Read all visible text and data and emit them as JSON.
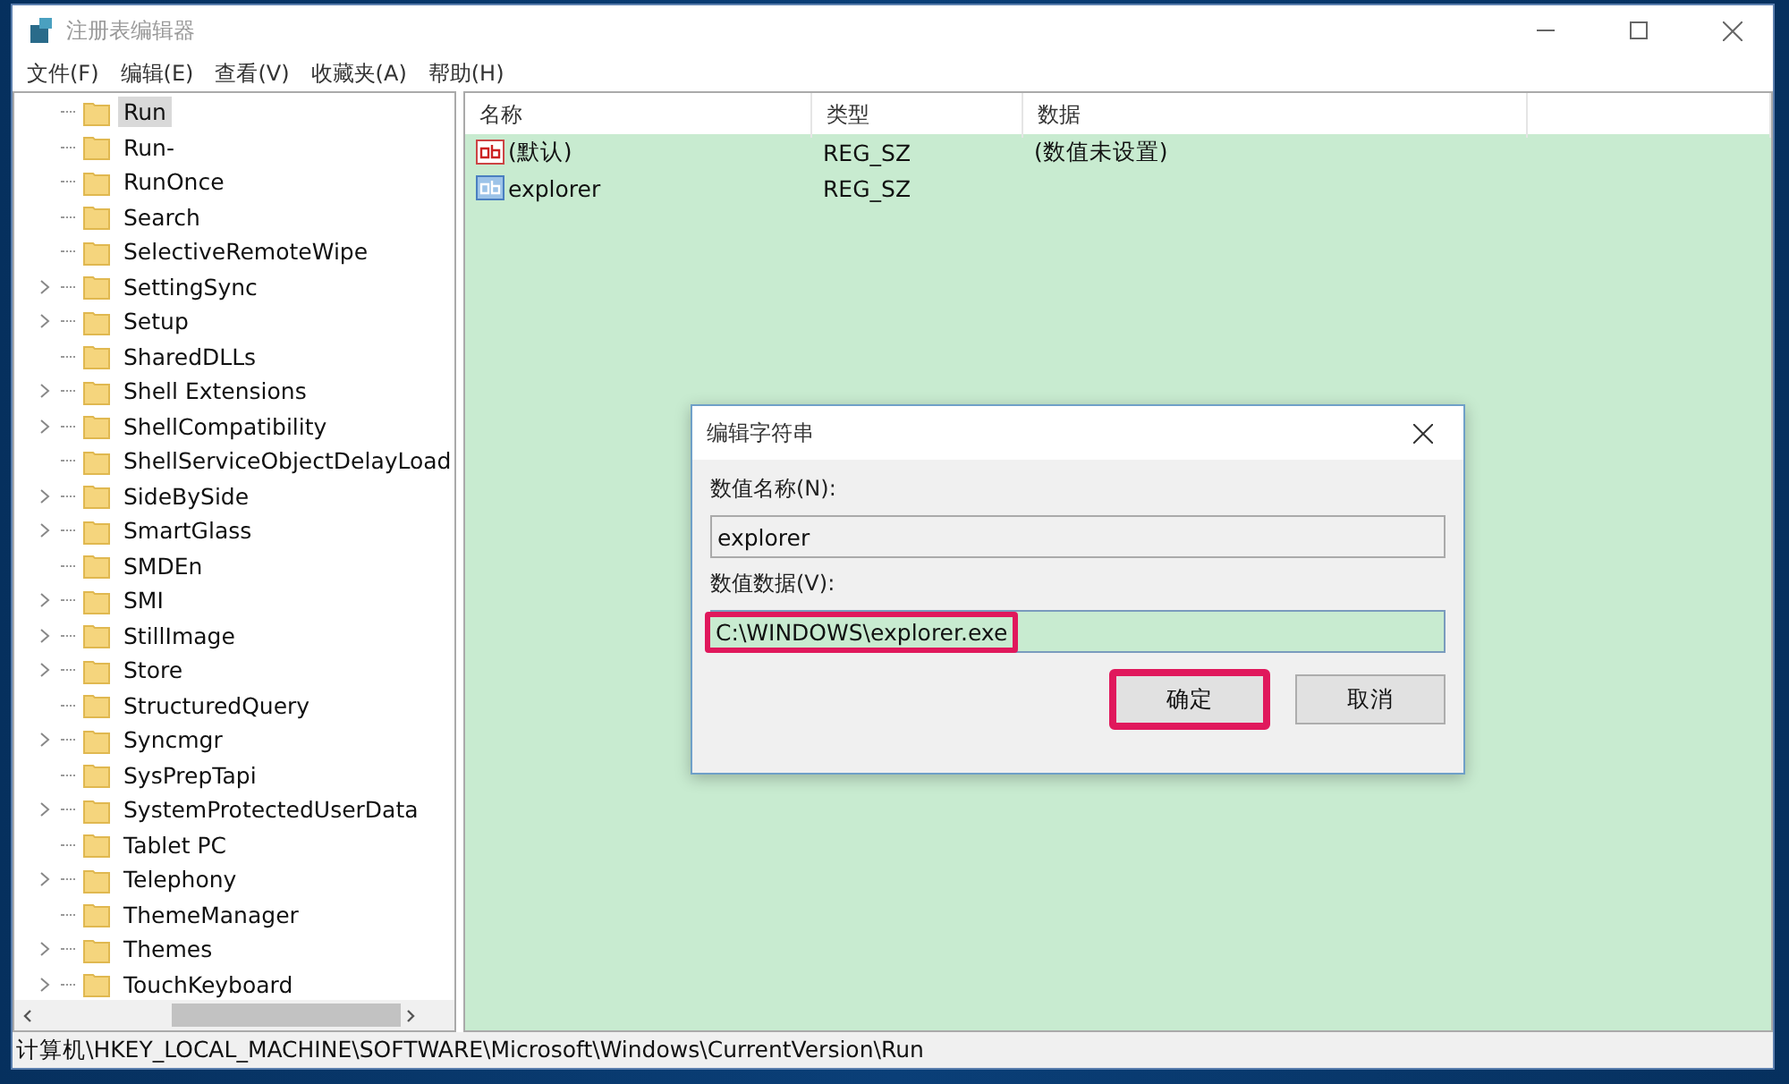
{
  "window": {
    "title": "注册表编辑器"
  },
  "menu": [
    "文件(F)",
    "编辑(E)",
    "查看(V)",
    "收藏夹(A)",
    "帮助(H)"
  ],
  "tree": [
    {
      "label": "Run",
      "expandable": false,
      "selected": true
    },
    {
      "label": "Run-",
      "expandable": false,
      "selected": false
    },
    {
      "label": "RunOnce",
      "expandable": false,
      "selected": false
    },
    {
      "label": "Search",
      "expandable": false,
      "selected": false
    },
    {
      "label": "SelectiveRemoteWipe",
      "expandable": false,
      "selected": false
    },
    {
      "label": "SettingSync",
      "expandable": true,
      "selected": false
    },
    {
      "label": "Setup",
      "expandable": true,
      "selected": false
    },
    {
      "label": "SharedDLLs",
      "expandable": false,
      "selected": false
    },
    {
      "label": "Shell Extensions",
      "expandable": true,
      "selected": false
    },
    {
      "label": "ShellCompatibility",
      "expandable": true,
      "selected": false
    },
    {
      "label": "ShellServiceObjectDelayLoad",
      "expandable": false,
      "selected": false
    },
    {
      "label": "SideBySide",
      "expandable": true,
      "selected": false
    },
    {
      "label": "SmartGlass",
      "expandable": true,
      "selected": false
    },
    {
      "label": "SMDEn",
      "expandable": false,
      "selected": false
    },
    {
      "label": "SMI",
      "expandable": true,
      "selected": false
    },
    {
      "label": "StillImage",
      "expandable": true,
      "selected": false
    },
    {
      "label": "Store",
      "expandable": true,
      "selected": false
    },
    {
      "label": "StructuredQuery",
      "expandable": false,
      "selected": false
    },
    {
      "label": "Syncmgr",
      "expandable": true,
      "selected": false
    },
    {
      "label": "SysPrepTapi",
      "expandable": false,
      "selected": false
    },
    {
      "label": "SystemProtectedUserData",
      "expandable": true,
      "selected": false
    },
    {
      "label": "Tablet PC",
      "expandable": false,
      "selected": false
    },
    {
      "label": "Telephony",
      "expandable": true,
      "selected": false
    },
    {
      "label": "ThemeManager",
      "expandable": false,
      "selected": false
    },
    {
      "label": "Themes",
      "expandable": true,
      "selected": false
    },
    {
      "label": "TouchKeyboard",
      "expandable": true,
      "selected": false
    }
  ],
  "table": {
    "columns": [
      "名称",
      "类型",
      "数据"
    ],
    "rows": [
      {
        "name": "(默认)",
        "type": "REG_SZ",
        "data": "(数值未设置)",
        "kind": "default"
      },
      {
        "name": "explorer",
        "type": "REG_SZ",
        "data": "",
        "kind": "string"
      }
    ]
  },
  "dialog": {
    "title": "编辑字符串",
    "name_label": "数值名称(N):",
    "name_value": "explorer",
    "data_label": "数值数据(V):",
    "data_value": "C:\\WINDOWS\\explorer.exe",
    "data_highlighted": true,
    "buttons": [
      {
        "label": "确定",
        "highlighted": true
      },
      {
        "label": "取消",
        "highlighted": false
      }
    ]
  },
  "status_bar": "计算机\\HKEY_LOCAL_MACHINE\\SOFTWARE\\Microsoft\\Windows\\CurrentVersion\\Run"
}
